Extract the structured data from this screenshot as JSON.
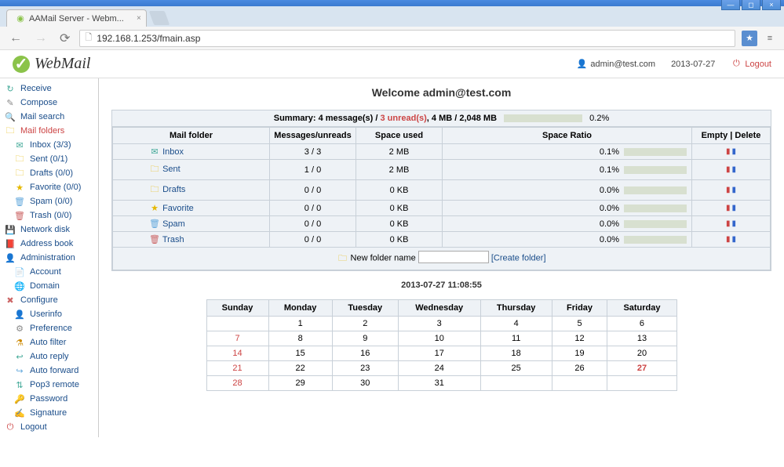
{
  "window": {
    "title": "AAMail Server - Webm..."
  },
  "browser": {
    "url": "192.168.1.253/fmain.asp"
  },
  "header": {
    "logo_text": "WebMail",
    "user": "admin@test.com",
    "date": "2013-07-27",
    "logout": "Logout"
  },
  "sidebar": {
    "receive": "Receive",
    "compose": "Compose",
    "mail_search": "Mail search",
    "mail_folders": "Mail folders",
    "inbox": "Inbox (3/3)",
    "sent": "Sent (0/1)",
    "drafts": "Drafts (0/0)",
    "favorite": "Favorite (0/0)",
    "spam": "Spam (0/0)",
    "trash": "Trash (0/0)",
    "network_disk": "Network disk",
    "address_book": "Address book",
    "administration": "Administration",
    "account": "Account",
    "domain": "Domain",
    "configure": "Configure",
    "userinfo": "Userinfo",
    "preference": "Preference",
    "auto_filter": "Auto filter",
    "auto_reply": "Auto reply",
    "auto_forward": "Auto forward",
    "pop3_remote": "Pop3 remote",
    "password": "Password",
    "signature": "Signature",
    "logout": "Logout"
  },
  "content": {
    "welcome": "Welcome admin@test.com",
    "summary_prefix": "Summary:  4 message(s) / ",
    "summary_unread": "3 unread(s)",
    "summary_suffix": ",  4 MB / 2,048 MB",
    "summary_pct": "0.2%",
    "cols": {
      "folder": "Mail folder",
      "messages": "Messages/unreads",
      "space_used": "Space used",
      "space_ratio": "Space Ratio",
      "actions": "Empty | Delete"
    },
    "folders": [
      {
        "name": "Inbox",
        "msgs": "3 / 3",
        "used": "2 MB",
        "ratio": "0.1%"
      },
      {
        "name": "Sent",
        "msgs": "1 / 0",
        "used": "2 MB",
        "ratio": "0.1%"
      },
      {
        "name": "Drafts",
        "msgs": "0 / 0",
        "used": "0 KB",
        "ratio": "0.0%"
      },
      {
        "name": "Favorite",
        "msgs": "0 / 0",
        "used": "0 KB",
        "ratio": "0.0%"
      },
      {
        "name": "Spam",
        "msgs": "0 / 0",
        "used": "0 KB",
        "ratio": "0.0%"
      },
      {
        "name": "Trash",
        "msgs": "0 / 0",
        "used": "0 KB",
        "ratio": "0.0%"
      }
    ],
    "new_folder_label": "New folder name",
    "create_folder": "[Create folder]",
    "timestamp": "2013-07-27 11:08:55",
    "calendar": {
      "days": [
        "Sunday",
        "Monday",
        "Tuesday",
        "Wednesday",
        "Thursday",
        "Friday",
        "Saturday"
      ],
      "rows": [
        [
          "",
          "1",
          "2",
          "3",
          "4",
          "5",
          "6"
        ],
        [
          "7",
          "8",
          "9",
          "10",
          "11",
          "12",
          "13"
        ],
        [
          "14",
          "15",
          "16",
          "17",
          "18",
          "19",
          "20"
        ],
        [
          "21",
          "22",
          "23",
          "24",
          "25",
          "26",
          "27"
        ],
        [
          "28",
          "29",
          "30",
          "31",
          "",
          "",
          ""
        ]
      ],
      "today": "27"
    }
  }
}
